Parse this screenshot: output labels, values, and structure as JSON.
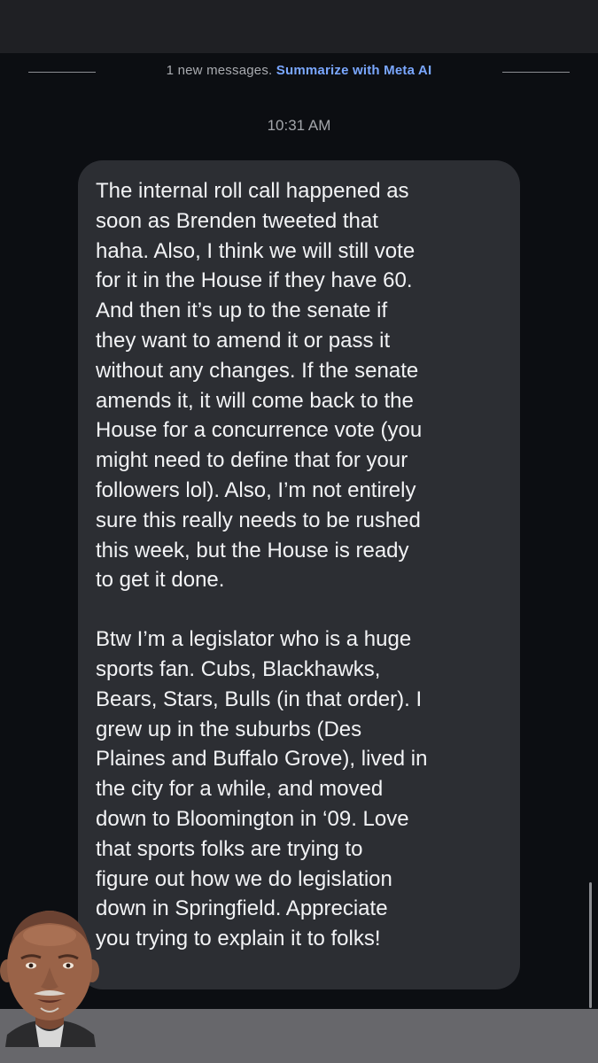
{
  "banner": {
    "new_messages_text": "1 new messages.",
    "summarize_label": "Summarize with Meta AI"
  },
  "timestamp": "10:31 AM",
  "message": {
    "paragraph_1": "The internal roll call happened as\nsoon as Brenden tweeted that\nhaha. Also, I think we will still vote\nfor it in the House if they have 60.\nAnd then it’s up to the senate if\nthey want to amend it or pass it\nwithout any changes. If the senate\namends it, it will come back to the\nHouse for a concurrence vote (you\nmight need to define that for your\nfollowers lol). Also, I’m not entirely\nsure this really needs to be rushed\nthis week, but the House is ready\nto get it done.",
    "paragraph_2": "Btw I’m a legislator who is a huge\nsports fan. Cubs, Blackhawks,\nBears, Stars, Bulls (in that order). I\ngrew up in the suburbs (Des\nPlaines and Buffalo Grove), lived in\nthe city for a while, and moved\ndown to Bloomington in ‘09. Love\nthat sports folks are trying to\nfigure out how we do legislation\ndown in Springfield. Appreciate\nyou trying to explain it to folks!"
  },
  "colors": {
    "background": "#0c0e12",
    "bubble": "#2c2e33",
    "link": "#7aa7ff"
  },
  "icons": {
    "avatar": "sender-avatar-photo"
  }
}
